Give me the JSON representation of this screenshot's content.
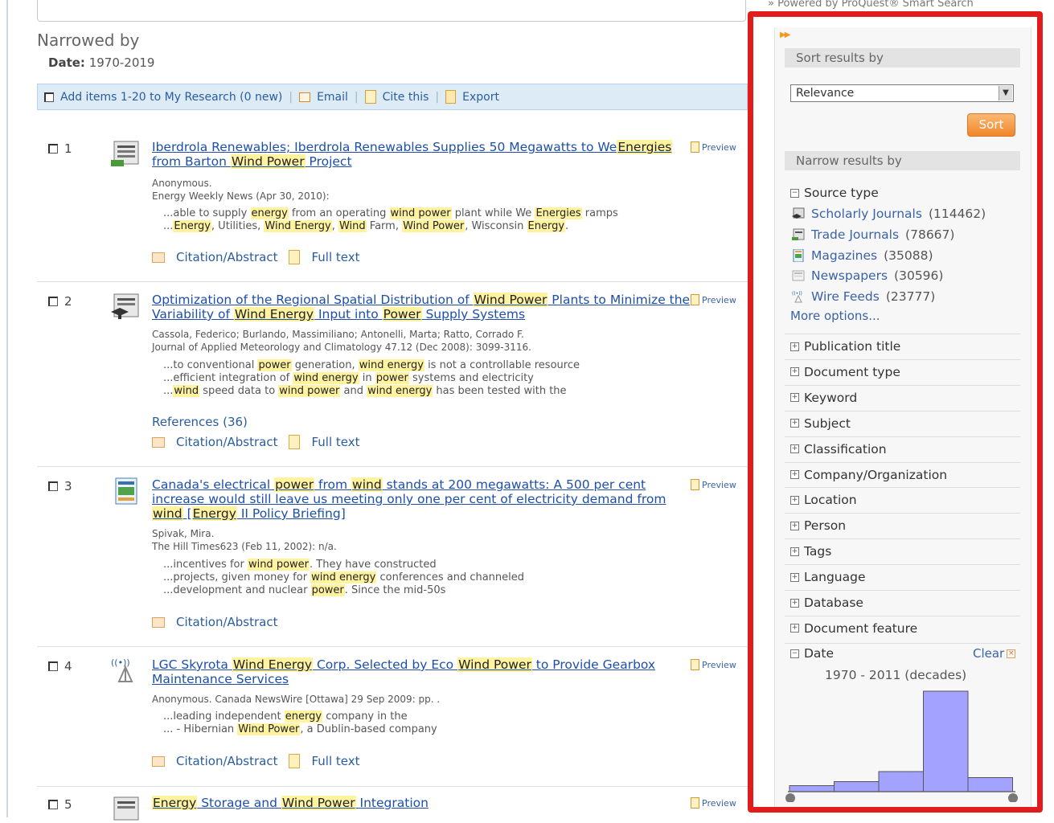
{
  "powered_by": "» Powered by ProQuest® Smart Search",
  "narrowed": {
    "title": "Narrowed by",
    "date_label": "Date:",
    "date_value": "1970-2019"
  },
  "actionbar": {
    "add_label": "Add items 1-20 to My Research (0 new)",
    "email": "Email",
    "cite": "Cite this",
    "export": "Export"
  },
  "preview_label": "Preview",
  "results": [
    {
      "num": "1",
      "title_parts": [
        {
          "t": "Iberdrola Renewables; Iberdrola Renewables Supplies 50 Megawatts to We",
          "h": false
        },
        {
          "t": "Energies",
          "h": true
        },
        {
          "t": " from Barton ",
          "h": false
        },
        {
          "t": "Wind Power",
          "h": true
        },
        {
          "t": " Project",
          "h": false
        }
      ],
      "meta": [
        "Anonymous.",
        "Energy Weekly News (Apr 30, 2010):"
      ],
      "snippets": [
        [
          {
            "t": "...able to supply ",
            "h": false
          },
          {
            "t": "energy",
            "h": true
          },
          {
            "t": " from an operating ",
            "h": false
          },
          {
            "t": "wind power",
            "h": true
          },
          {
            "t": " plant while We ",
            "h": false
          },
          {
            "t": "Energies",
            "h": true
          },
          {
            "t": " ramps",
            "h": false
          }
        ],
        [
          {
            "t": "...",
            "h": false
          },
          {
            "t": "Energy",
            "h": true
          },
          {
            "t": ", Utilities, ",
            "h": false
          },
          {
            "t": "Wind Energy",
            "h": true
          },
          {
            "t": ", ",
            "h": false
          },
          {
            "t": "Wind",
            "h": true
          },
          {
            "t": " Farm, ",
            "h": false
          },
          {
            "t": "Wind Power",
            "h": true
          },
          {
            "t": ", Wisconsin ",
            "h": false
          },
          {
            "t": "Energy",
            "h": true
          },
          {
            "t": ".",
            "h": false
          }
        ]
      ],
      "references": "",
      "citation": "Citation/Abstract",
      "fulltext": "Full text"
    },
    {
      "num": "2",
      "title_parts": [
        {
          "t": "Optimization of the Regional Spatial Distribution of ",
          "h": false
        },
        {
          "t": "Wind Power",
          "h": true
        },
        {
          "t": " Plants to Minimize the Variability of ",
          "h": false
        },
        {
          "t": "Wind Energy",
          "h": true
        },
        {
          "t": " Input into ",
          "h": false
        },
        {
          "t": "Power",
          "h": true
        },
        {
          "t": " Supply Systems",
          "h": false
        }
      ],
      "meta": [
        "Cassola, Federico; Burlando, Massimiliano; Antonelli, Marta; Ratto, Corrado F.",
        "Journal of Applied Meteorology and Climatology 47.12 (Dec 2008): 3099-3116."
      ],
      "snippets": [
        [
          {
            "t": "...to conventional ",
            "h": false
          },
          {
            "t": "power",
            "h": true
          },
          {
            "t": " generation, ",
            "h": false
          },
          {
            "t": "wind energy",
            "h": true
          },
          {
            "t": " is not a controllable resource",
            "h": false
          }
        ],
        [
          {
            "t": "...efficient integration of ",
            "h": false
          },
          {
            "t": "wind energy",
            "h": true
          },
          {
            "t": " in ",
            "h": false
          },
          {
            "t": "power",
            "h": true
          },
          {
            "t": " systems and electricity",
            "h": false
          }
        ],
        [
          {
            "t": "...",
            "h": false
          },
          {
            "t": "wind",
            "h": true
          },
          {
            "t": " speed data to ",
            "h": false
          },
          {
            "t": "wind power",
            "h": true
          },
          {
            "t": " and ",
            "h": false
          },
          {
            "t": "wind energy",
            "h": true
          },
          {
            "t": " has been tested with the",
            "h": false
          }
        ]
      ],
      "references": "References (36)",
      "citation": "Citation/Abstract",
      "fulltext": "Full text"
    },
    {
      "num": "3",
      "title_parts": [
        {
          "t": "Canada's electrical ",
          "h": false
        },
        {
          "t": "power",
          "h": true
        },
        {
          "t": " from ",
          "h": false
        },
        {
          "t": "wind",
          "h": true
        },
        {
          "t": " stands at 200 megawatts: A 500 per cent increase would still leave us meeting only one per cent of electricity demand from ",
          "h": false
        },
        {
          "t": "wind",
          "h": true
        },
        {
          "t": " [",
          "h": false
        },
        {
          "t": "Energy",
          "h": true
        },
        {
          "t": " II Policy Briefing]",
          "h": false
        }
      ],
      "meta": [
        "Spivak, Mira.",
        "The Hill Times623 (Feb 11, 2002): n/a."
      ],
      "snippets": [
        [
          {
            "t": "...incentives for ",
            "h": false
          },
          {
            "t": "wind power",
            "h": true
          },
          {
            "t": ". They have constructed",
            "h": false
          }
        ],
        [
          {
            "t": "...projects, given money for ",
            "h": false
          },
          {
            "t": "wind energy",
            "h": true
          },
          {
            "t": " conferences and channeled",
            "h": false
          }
        ],
        [
          {
            "t": "...development and nuclear ",
            "h": false
          },
          {
            "t": "power",
            "h": true
          },
          {
            "t": ". Since the mid-50s",
            "h": false
          }
        ]
      ],
      "references": "",
      "citation": "Citation/Abstract",
      "fulltext": ""
    },
    {
      "num": "4",
      "title_parts": [
        {
          "t": "LGC Skyrota ",
          "h": false
        },
        {
          "t": "Wind Energy",
          "h": true
        },
        {
          "t": " Corp. Selected by Eco ",
          "h": false
        },
        {
          "t": "Wind Power",
          "h": true
        },
        {
          "t": " to Provide Gearbox Maintenance Services",
          "h": false
        }
      ],
      "meta": [
        "Anonymous. Canada NewsWire [Ottawa] 29 Sep 2009: pp. ."
      ],
      "snippets": [
        [
          {
            "t": "...leading independent ",
            "h": false
          },
          {
            "t": "energy",
            "h": true
          },
          {
            "t": " company in the",
            "h": false
          }
        ],
        [
          {
            "t": "... - Hibernian ",
            "h": false
          },
          {
            "t": "Wind Power",
            "h": true
          },
          {
            "t": ", a Dublin-based company",
            "h": false
          }
        ]
      ],
      "references": "",
      "citation": "Citation/Abstract",
      "fulltext": "Full text"
    },
    {
      "num": "5",
      "title_parts": [
        {
          "t": "Energy",
          "h": true
        },
        {
          "t": " Storage and ",
          "h": false
        },
        {
          "t": "Wind Power",
          "h": true
        },
        {
          "t": " Integration",
          "h": false
        }
      ],
      "meta": [],
      "snippets": [],
      "references": "",
      "citation": "",
      "fulltext": ""
    }
  ],
  "sidebar": {
    "sort_header": "Sort results by",
    "sort_selected": "Relevance",
    "sort_button": "Sort",
    "narrow_header": "Narrow results by",
    "source_type_label": "Source type",
    "sources": [
      {
        "label": "Scholarly Journals",
        "count": "(114462)",
        "icon": "scholarly-journal-icon"
      },
      {
        "label": "Trade Journals",
        "count": "(78667)",
        "icon": "trade-journal-icon"
      },
      {
        "label": "Magazines",
        "count": "(35088)",
        "icon": "magazine-icon"
      },
      {
        "label": "Newspapers",
        "count": "(30596)",
        "icon": "newspaper-icon"
      },
      {
        "label": "Wire Feeds",
        "count": "(23777)",
        "icon": "wire-feed-icon"
      }
    ],
    "more_options": "More options...",
    "facets": [
      "Publication title",
      "Document type",
      "Keyword",
      "Subject",
      "Classification",
      "Company/Organization",
      "Location",
      "Person",
      "Tags",
      "Language",
      "Database",
      "Document feature"
    ],
    "date_label": "Date",
    "clear_label": "Clear",
    "date_range": "1970 - 2011 (decades)",
    "histogram_relative_heights": [
      0.06,
      0.1,
      0.2,
      1.0,
      0.14
    ],
    "histogram_color": "#a3a3ff"
  },
  "colors": {
    "highlight": "#fff3a0",
    "link": "#1e4fa8",
    "panel_outline": "#e21b1b",
    "sort_button": "#f0862a"
  }
}
